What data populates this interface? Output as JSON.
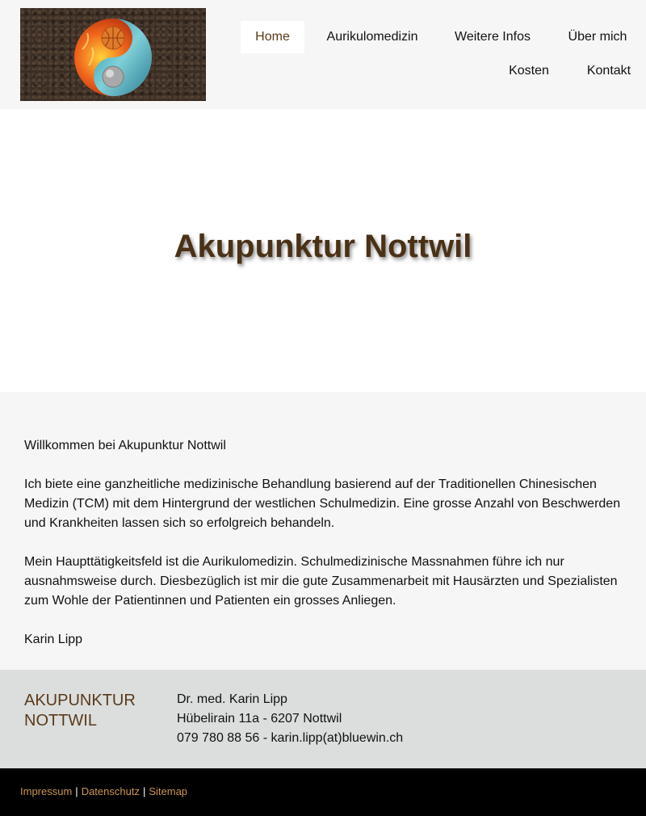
{
  "header": {
    "logo_icon": "yin-yang-fire-water-icon",
    "nav": [
      {
        "label": "Home",
        "active": true
      },
      {
        "label": "Aurikulomedizin"
      },
      {
        "label": "Weitere Infos"
      },
      {
        "label": "Über mich"
      },
      {
        "label": "Kosten"
      },
      {
        "label": "Kontakt"
      }
    ]
  },
  "hero": {
    "title": "Akupunktur Nottwil"
  },
  "main": {
    "paragraphs": [
      "Willkommen bei Akupunktur Nottwil",
      "Ich biete eine ganzheitliche medizinische Behandlung basierend auf der Traditionellen Chinesischen Medizin (TCM) mit dem Hintergrund der westlichen Schulmedizin. Eine grosse Anzahl von Beschwerden und Krankheiten lassen sich so erfolgreich behandeln.",
      "Mein Haupttätigkeitsfeld ist die Aurikulomedizin. Schulmedizinische Massnahmen führe ich nur ausnahmsweise durch. Diesbezüglich ist mir die gute Zusammenarbeit mit Hausärzten und Spezialisten zum Wohle der Patientinnen und Patienten ein grosses Anliegen.",
      "Karin Lipp"
    ]
  },
  "footer": {
    "brand_line1": "AKUPUNKTUR",
    "brand_line2": "NOTTWIL",
    "name": "Dr. med. Karin Lipp",
    "address": "Hübelirain 11a - 6207 Nottwil",
    "contact": "079 780 88 56 - karin.lipp(at)bluewin.ch"
  },
  "bottom_links": {
    "impressum": "Impressum",
    "datenschutz": "Datenschutz",
    "sitemap": "Sitemap",
    "separator": "|"
  },
  "colors": {
    "accent_brown": "#5a3a18",
    "link_orange": "#c9964f",
    "footer_bg": "#dcdede",
    "content_bg": "#f5f6f5"
  }
}
